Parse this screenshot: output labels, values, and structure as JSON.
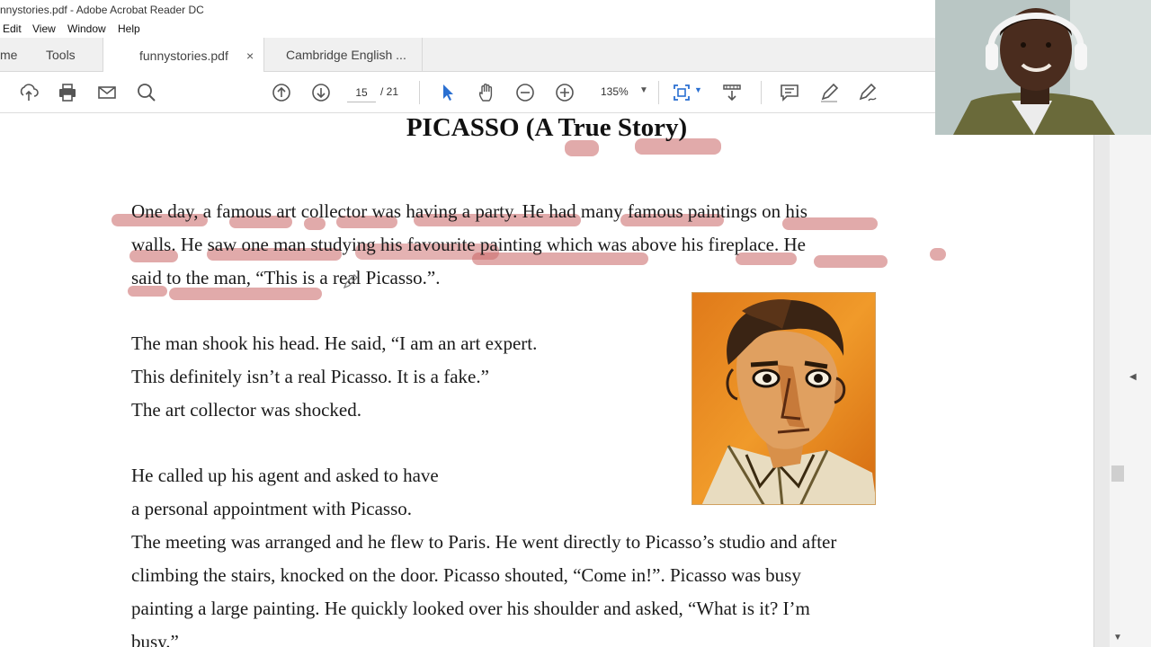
{
  "window": {
    "title": "nnystories.pdf - Adobe Acrobat Reader DC"
  },
  "menu": [
    "Edit",
    "View",
    "Window",
    "Help"
  ],
  "tabs": {
    "home": "me",
    "tools": "Tools",
    "active_doc": "funnystories.pdf",
    "close_glyph": "×",
    "other_doc": "Cambridge English ..."
  },
  "toolbar": {
    "current_page": "15",
    "page_separator": "/ 21",
    "zoom": "135%",
    "icons": [
      "upload-icon",
      "print-icon",
      "mail-icon",
      "search-icon",
      "page-up-icon",
      "page-down-icon",
      "select-arrow-icon",
      "hand-icon",
      "zoom-out-icon",
      "zoom-in-icon",
      "fit-page-icon",
      "scroll-mode-icon",
      "comment-icon",
      "highlight-pen-icon",
      "sign-icon"
    ]
  },
  "document": {
    "title": "PICASSO (A True Story)",
    "paragraph1": [
      "One day, a famous art collector was having a party. He had many famous paintings on his",
      "walls.    He saw one man studying his favourite painting which was above his fireplace. He",
      "said to the man, “This is a real Picasso.”."
    ],
    "paragraph2": [
      "The man shook his head. He said, “I am an art expert.",
      "This definitely isn’t a real Picasso. It is a fake.”",
      "The art collector was shocked."
    ],
    "paragraph3": [
      "He called up his agent and asked to have",
      "a personal appointment with Picasso.",
      "The meeting was arranged and he flew to Paris. He went directly to Picasso’s studio and after",
      "climbing the stairs, knocked on the door. Picasso shouted, “Come in!”. Picasso was busy",
      "painting a large painting. He quickly looked over his shoulder and asked, “What is it? I’m",
      "busy.”"
    ]
  },
  "colors": {
    "highlight": "#c86464",
    "toolbar_blue": "#2a6fd1"
  }
}
